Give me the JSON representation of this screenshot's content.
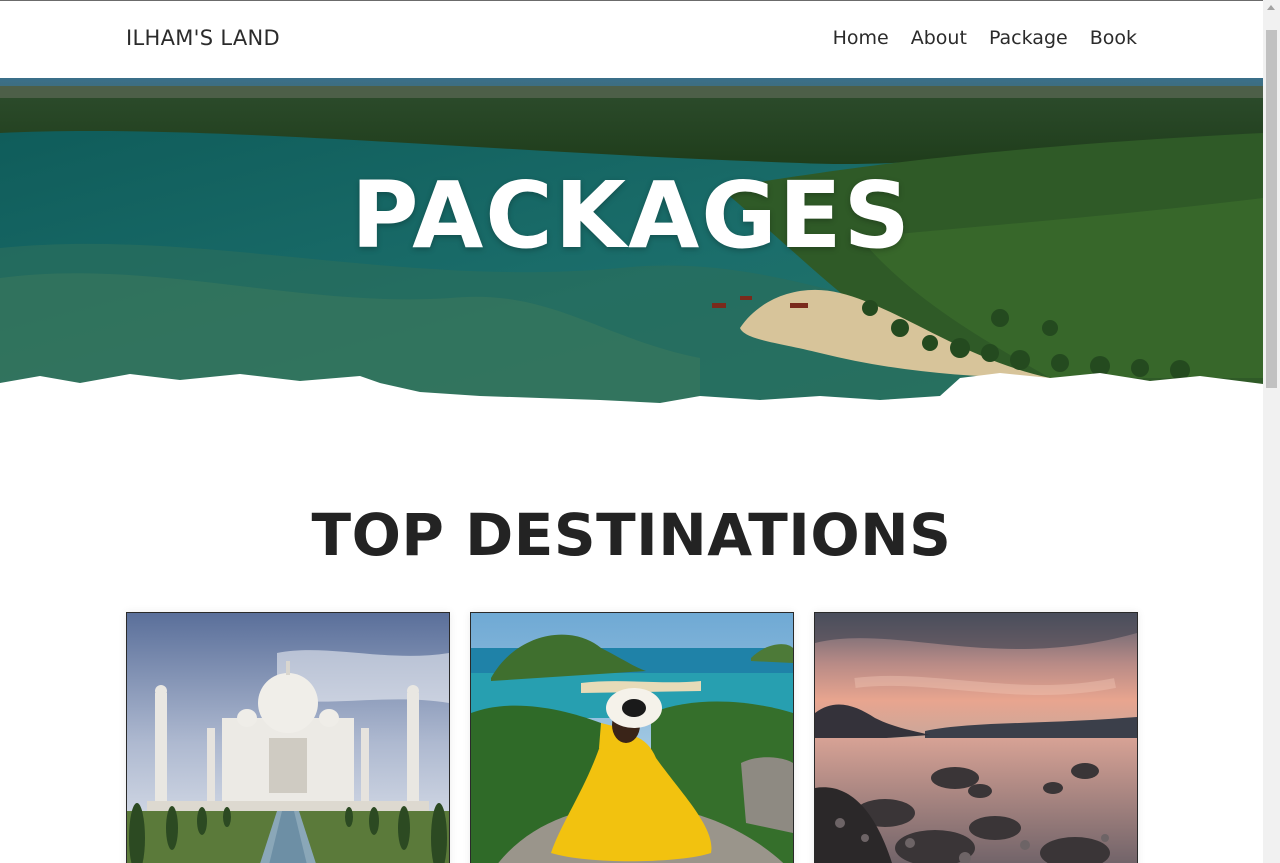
{
  "navbar": {
    "brand": "ILHAM'S LAND",
    "links": [
      "Home",
      "About",
      "Package",
      "Book"
    ]
  },
  "hero": {
    "title": "PACKAGES"
  },
  "section": {
    "title": "TOP DESTINATIONS"
  },
  "cards": [
    {
      "image": "taj-mahal-photo"
    },
    {
      "image": "woman-yellow-dress-island-photo"
    },
    {
      "image": "rocky-beach-sunset-photo"
    }
  ],
  "colors": {
    "text_dark": "#232323",
    "hero_text": "#ffffff",
    "scrollbar_thumb": "#c1c1c1"
  }
}
